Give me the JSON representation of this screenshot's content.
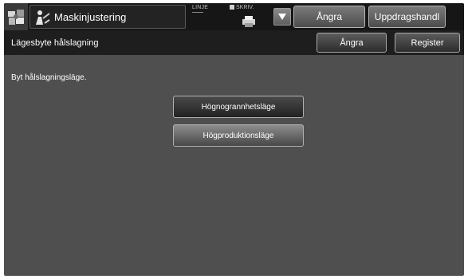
{
  "header": {
    "title": "Maskinjustering",
    "status_linje": "LINJE",
    "status_skriv": "SKRIV.",
    "undo_label": "Ångra",
    "job_status_label": "Uppdragshandl"
  },
  "subheader": {
    "title": "Lägesbyte hålslagning",
    "undo_label": "Ångra",
    "register_label": "Register"
  },
  "main": {
    "instruction": "Byt hålslagningsläge.",
    "options": [
      {
        "label": "Högnogrannhetsläge",
        "selected": false
      },
      {
        "label": "Högproduktionsläge",
        "selected": true
      }
    ]
  },
  "icons": [
    "home-icon",
    "machine-adjust-icon",
    "printer-icon",
    "chevron-down-icon"
  ]
}
